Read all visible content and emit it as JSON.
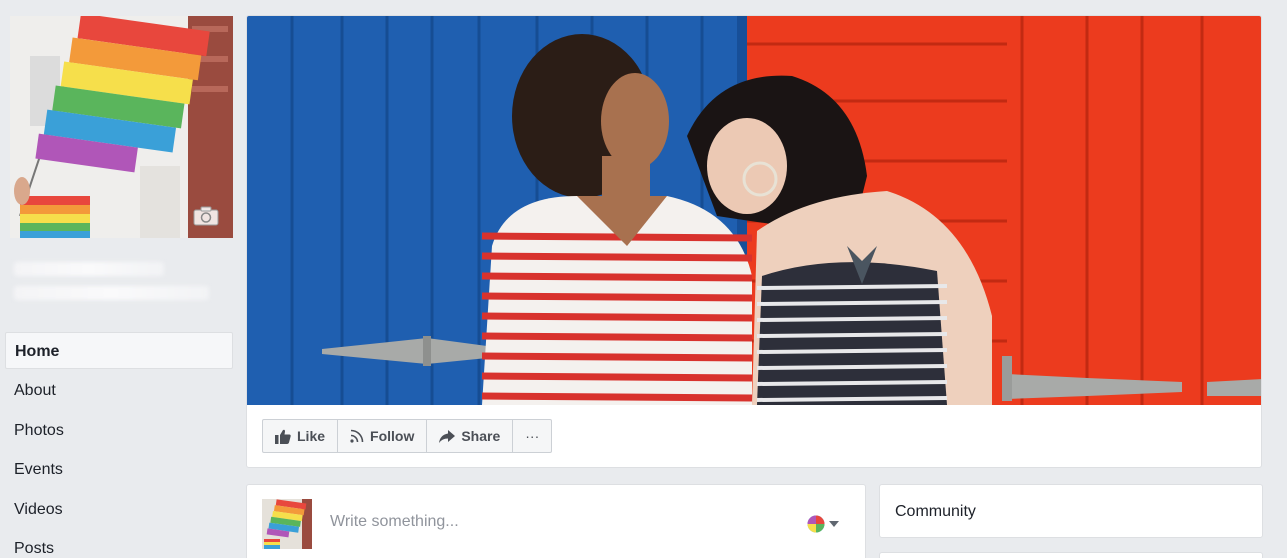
{
  "nav": {
    "items": [
      {
        "label": "Home",
        "active": true
      },
      {
        "label": "About",
        "active": false
      },
      {
        "label": "Photos",
        "active": false
      },
      {
        "label": "Events",
        "active": false
      },
      {
        "label": "Videos",
        "active": false
      },
      {
        "label": "Posts",
        "active": false
      }
    ]
  },
  "actions": {
    "like": "Like",
    "follow": "Follow",
    "share": "Share",
    "more": "···"
  },
  "composer": {
    "placeholder": "Write something..."
  },
  "sidebar": {
    "community_title": "Community"
  },
  "colors": {
    "page_bg": "#e9ebee",
    "card_border": "#dddfe2",
    "action_text": "#4b4f56",
    "placeholder": "#90949c"
  },
  "icons": {
    "like": "thumbs-up-icon",
    "follow": "rss-icon",
    "share": "share-arrow-icon",
    "camera": "camera-icon",
    "audience": "rainbow-globe-icon"
  }
}
